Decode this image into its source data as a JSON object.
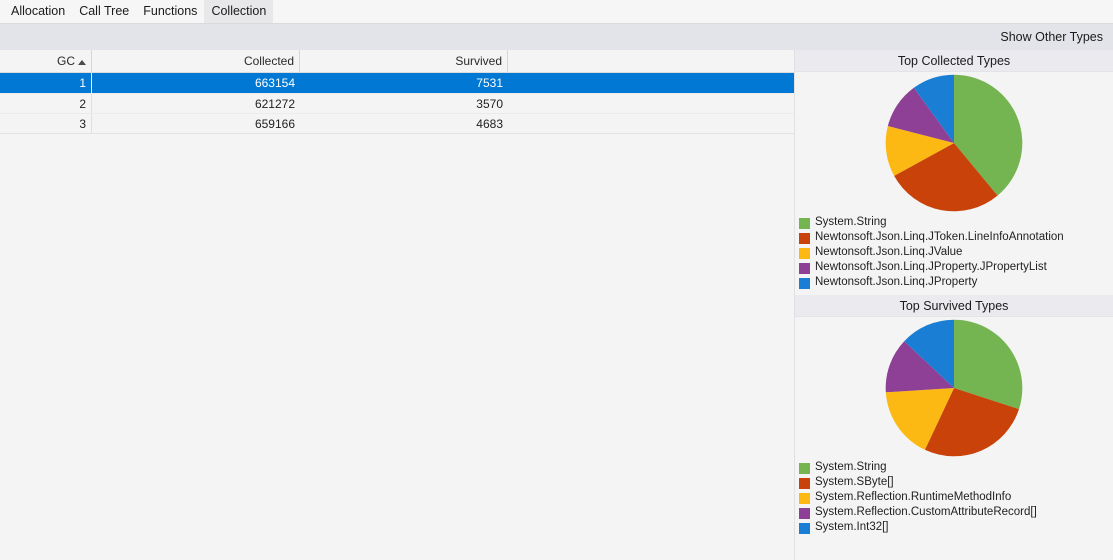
{
  "tabs": [
    {
      "label": "Allocation",
      "active": false
    },
    {
      "label": "Call Tree",
      "active": false
    },
    {
      "label": "Functions",
      "active": false
    },
    {
      "label": "Collection",
      "active": true
    }
  ],
  "toolbar": {
    "show_other_types_label": "Show Other Types"
  },
  "grid": {
    "columns": [
      {
        "key": "gc",
        "label": "GC",
        "sorted": true,
        "sort_direction": "asc"
      },
      {
        "key": "collected",
        "label": "Collected",
        "sorted": false
      },
      {
        "key": "survived",
        "label": "Survived",
        "sorted": false
      }
    ],
    "rows": [
      {
        "gc": "1",
        "collected": "663154",
        "survived": "7531",
        "selected": true
      },
      {
        "gc": "2",
        "collected": "621272",
        "survived": "3570",
        "selected": false
      },
      {
        "gc": "3",
        "collected": "659166",
        "survived": "4683",
        "selected": false
      }
    ]
  },
  "panels": [
    {
      "title": "Top Collected Types",
      "chart_data": {
        "type": "pie",
        "title": "Top Collected Types",
        "legend_position": "bottom",
        "labels": [
          "System.String",
          "Newtonsoft.Json.Linq.JToken.LineInfoAnnotation",
          "Newtonsoft.Json.Linq.JValue",
          "Newtonsoft.Json.Linq.JProperty.JPropertyList",
          "Newtonsoft.Json.Linq.JProperty"
        ],
        "values": [
          39,
          28,
          12,
          11,
          10
        ],
        "colors": [
          "#74b451",
          "#c8420a",
          "#fcb813",
          "#8e4096",
          "#1a7fd4"
        ]
      }
    },
    {
      "title": "Top Survived Types",
      "chart_data": {
        "type": "pie",
        "title": "Top Survived Types",
        "legend_position": "bottom",
        "labels": [
          "System.String",
          "System.SByte[]",
          "System.Reflection.RuntimeMethodInfo",
          "System.Reflection.CustomAttributeRecord[]",
          "System.Int32[]"
        ],
        "values": [
          30,
          27,
          17,
          13,
          13
        ],
        "colors": [
          "#74b451",
          "#c8420a",
          "#fcb813",
          "#8e4096",
          "#1a7fd4"
        ]
      }
    }
  ],
  "theme": {
    "selection_color": "#0078d4",
    "toolbar_bg": "#e3e4e9",
    "content_bg": "#f4f4f4",
    "panel_header_bg": "#ebebef"
  }
}
